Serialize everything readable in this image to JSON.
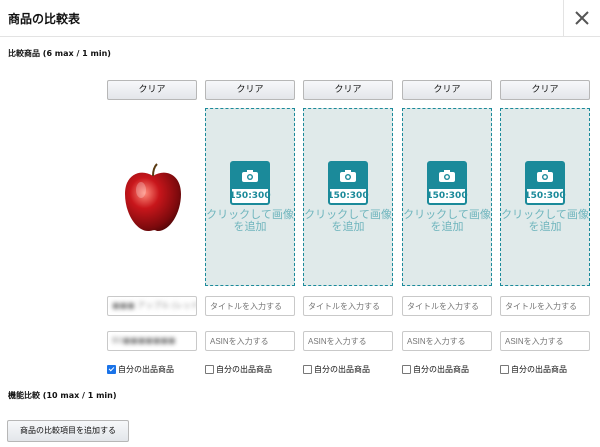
{
  "header": {
    "title": "商品の比較表",
    "close_icon": "close-icon"
  },
  "sections": {
    "products_label": "比較商品 (6 max / 1 min)",
    "features_label": "機能比較 (10 max / 1 min)"
  },
  "columns": [
    {
      "clear_label": "クリア",
      "has_image": true,
      "image_icon": "red-apple",
      "title_value": "■■■ アップル (レッド)",
      "asin_value": "B0■■■■■■■",
      "checkbox_label": "自分の出品商品",
      "checked": true
    },
    {
      "clear_label": "クリア",
      "has_image": false,
      "camera_text": "150:300",
      "drop_text": "クリックして画像を追加",
      "title_placeholder": "タイトルを入力する",
      "asin_placeholder": "ASINを入力する",
      "checkbox_label": "自分の出品商品",
      "checked": false
    },
    {
      "clear_label": "クリア",
      "has_image": false,
      "camera_text": "150:300",
      "drop_text": "クリックして画像を追加",
      "title_placeholder": "タイトルを入力する",
      "asin_placeholder": "ASINを入力する",
      "checkbox_label": "自分の出品商品",
      "checked": false
    },
    {
      "clear_label": "クリア",
      "has_image": false,
      "camera_text": "150:300",
      "drop_text": "クリックして画像を追加",
      "title_placeholder": "タイトルを入力する",
      "asin_placeholder": "ASINを入力する",
      "checkbox_label": "自分の出品商品",
      "checked": false
    },
    {
      "clear_label": "クリア",
      "has_image": false,
      "camera_text": "150:300",
      "drop_text": "クリックして画像を追加",
      "title_placeholder": "タイトルを入力する",
      "asin_placeholder": "ASINを入力する",
      "checkbox_label": "自分の出品商品",
      "checked": false
    }
  ],
  "add_button_label": "商品の比較項目を追加する",
  "colors": {
    "accent": "#1b8a9a",
    "dropzone_bg": "#e0eaea",
    "checkbox_on": "#1a73e8"
  }
}
